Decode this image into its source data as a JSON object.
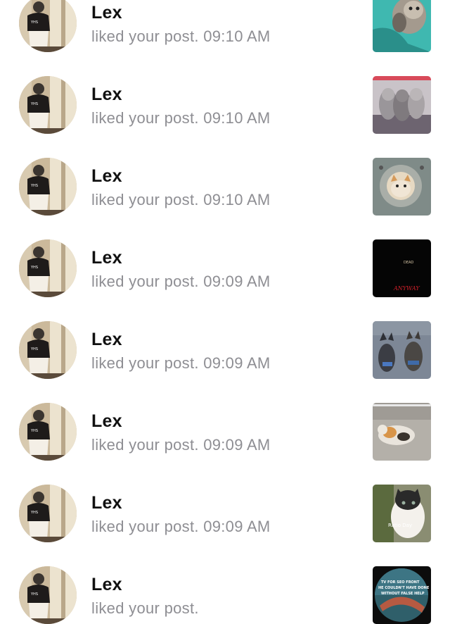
{
  "notifications": [
    {
      "user": "Lex",
      "action": "liked your post.",
      "time": "09:10 AM",
      "thumbnail": "kitten-on-teal-blanket"
    },
    {
      "user": "Lex",
      "action": "liked your post.",
      "time": "09:10 AM",
      "thumbnail": "three-kittens-on-blanket"
    },
    {
      "user": "Lex",
      "action": "liked your post.",
      "time": "09:10 AM",
      "thumbnail": "kitten-in-cat-tree-hole"
    },
    {
      "user": "Lex",
      "action": "liked your post.",
      "time": "09:09 AM",
      "thumbnail": "dark-text-image"
    },
    {
      "user": "Lex",
      "action": "liked your post.",
      "time": "09:09 AM",
      "thumbnail": "two-dogs-on-pavement"
    },
    {
      "user": "Lex",
      "action": "liked your post.",
      "time": "09:09 AM",
      "thumbnail": "calico-cat-on-ground"
    },
    {
      "user": "Lex",
      "action": "liked your post.",
      "time": "09:09 AM",
      "thumbnail": "cat-closeup-photo"
    },
    {
      "user": "Lex",
      "action": "liked your post.",
      "time": "",
      "thumbnail": "circular-text-meme"
    }
  ],
  "thumbnail_text": {
    "dark_top": "DEAD",
    "dark_bottom": "ANYWAY",
    "cat_caption": "Ratio Day",
    "meme_line1": "TV FOR SEO FRONT",
    "meme_line2": "HE COULDN'T HAVE DONE",
    "meme_line3": "WITHOUT FALSE HELP"
  },
  "colors": {
    "name": "#111111",
    "secondary": "#8e8e93",
    "background": "#ffffff"
  }
}
